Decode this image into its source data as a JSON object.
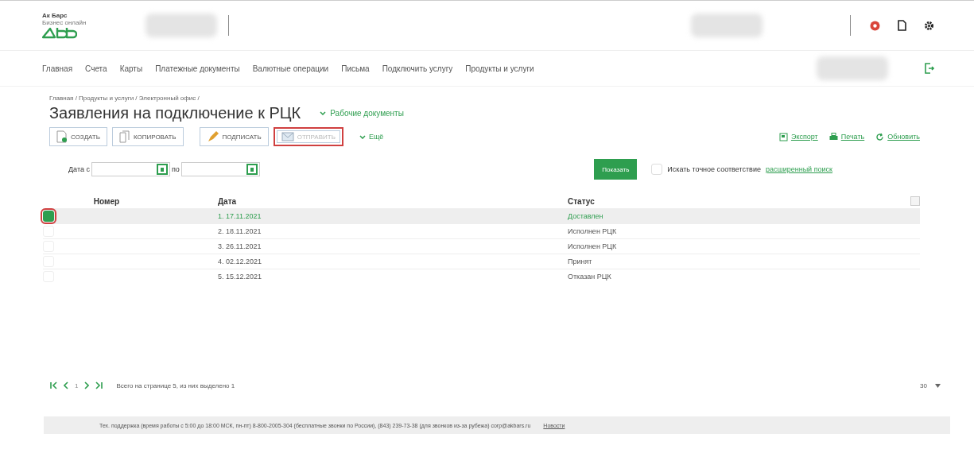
{
  "brand": {
    "line1": "Ак Барс",
    "line2": "Бизнес онлайн"
  },
  "nav": [
    "Главная",
    "Счета",
    "Карты",
    "Платежные документы",
    "Валютные операции",
    "Письма",
    "Подключить услугу",
    "Продукты и услуги"
  ],
  "breadcrumbs": "Главная / Продукты и услуги / Электронный офис /",
  "title": "Заявления на подключение к РЦК",
  "work_docs": "Рабочие документы",
  "toolbar": [
    {
      "label": "СОЗДАТЬ",
      "kind": "create",
      "disabled": false,
      "highlighted": false
    },
    {
      "label": "КОПИРОВАТЬ",
      "kind": "copy",
      "disabled": false,
      "highlighted": false
    },
    {
      "label": "ПОДПИСАТЬ",
      "kind": "sign",
      "disabled": false,
      "highlighted": false
    },
    {
      "label": "ОТПРАВИТЬ",
      "kind": "send",
      "disabled": true,
      "highlighted": true
    }
  ],
  "more": "Ещё",
  "actions": [
    {
      "label": "Экспорт",
      "kind": "export"
    },
    {
      "label": "Печать",
      "kind": "print"
    },
    {
      "label": "Обновить",
      "kind": "refresh"
    }
  ],
  "filter": {
    "date_from_label": "Дата с",
    "date_to_label": "по",
    "show_button": "Показать",
    "exact_label": "Искать точное соответствие",
    "exact_checked": false,
    "advanced": "расширенный поиск"
  },
  "table": {
    "columns": [
      "Номер",
      "Дата",
      "Статус"
    ],
    "rows": [
      {
        "index": "1.",
        "date": "17.11.2021",
        "status": "Доставлен",
        "selected": true
      },
      {
        "index": "2.",
        "date": "18.11.2021",
        "status": "Исполнен РЦК",
        "selected": false
      },
      {
        "index": "3.",
        "date": "26.11.2021",
        "status": "Исполнен РЦК",
        "selected": false
      },
      {
        "index": "4.",
        "date": "02.12.2021",
        "status": "Принят",
        "selected": false
      },
      {
        "index": "5.",
        "date": "15.12.2021",
        "status": "Отказан РЦК",
        "selected": false
      }
    ]
  },
  "pager": {
    "page": "1",
    "summary": "Всего на странице 5, из них выделено 1",
    "page_size": "30"
  },
  "footer": {
    "text": "Тех. поддержка (время работы с 5:00 до 18:00 МСК, пн-пт) 8-800-2005-304 (бесплатные звонки по России), (843) 239-73-38 (для звонков из-за рубежа) corp@akbars.ru",
    "news": "Новости"
  }
}
